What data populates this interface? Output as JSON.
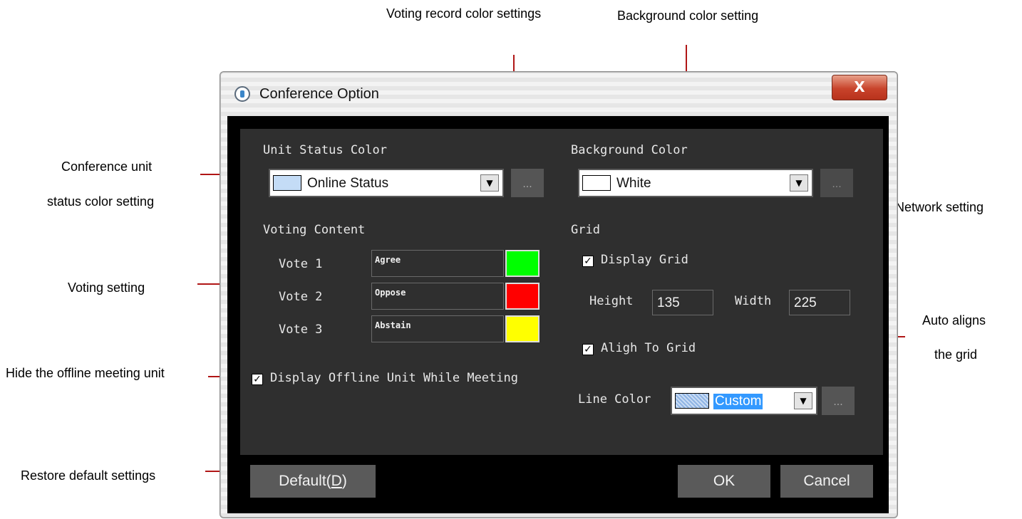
{
  "callouts": {
    "voting_record": "Voting record color settings",
    "background": "Background color setting",
    "unit_status_line1": "Conference unit",
    "unit_status_line2": "status color setting",
    "network": "Network setting",
    "voting": "Voting setting",
    "auto_align_line1": "Auto aligns",
    "auto_align_line2": "the grid",
    "hide_offline": "Hide the offline meeting unit",
    "restore_default": "Restore default settings"
  },
  "window": {
    "title": "Conference Option",
    "close_label": "X"
  },
  "unit_status": {
    "label": "Unit Status Color",
    "value": "Online Status",
    "swatch_color": "#c4dcf6",
    "browse_label": "..."
  },
  "background": {
    "label": "Background Color",
    "value": "White",
    "swatch_color": "#ffffff",
    "browse_label": "..."
  },
  "voting": {
    "label": "Voting Content",
    "items": [
      {
        "label": "Vote 1",
        "value": "Agree",
        "color": "#00ff00"
      },
      {
        "label": "Vote 2",
        "value": "Oppose",
        "color": "#ff0000"
      },
      {
        "label": "Vote 3",
        "value": "Abstain",
        "color": "#ffff00"
      }
    ]
  },
  "offline": {
    "label": "Display Offline Unit While Meeting",
    "checked": true
  },
  "grid": {
    "label": "Grid",
    "display_label": "Display Grid",
    "display_checked": true,
    "height_label": "Height",
    "height_value": "135",
    "width_label": "Width",
    "width_value": "225",
    "align_label": "Aligh To Grid",
    "align_checked": true,
    "line_color_label": "Line Color",
    "line_color_value": "Custom",
    "browse_label": "..."
  },
  "buttons": {
    "default_prefix": "Default(",
    "default_mnemonic": "D",
    "default_suffix": ")",
    "ok": "OK",
    "cancel": "Cancel"
  },
  "colors": {
    "leader": "#b01616",
    "panel_bg": "#2f2f2f",
    "selection": "#3399ff"
  }
}
